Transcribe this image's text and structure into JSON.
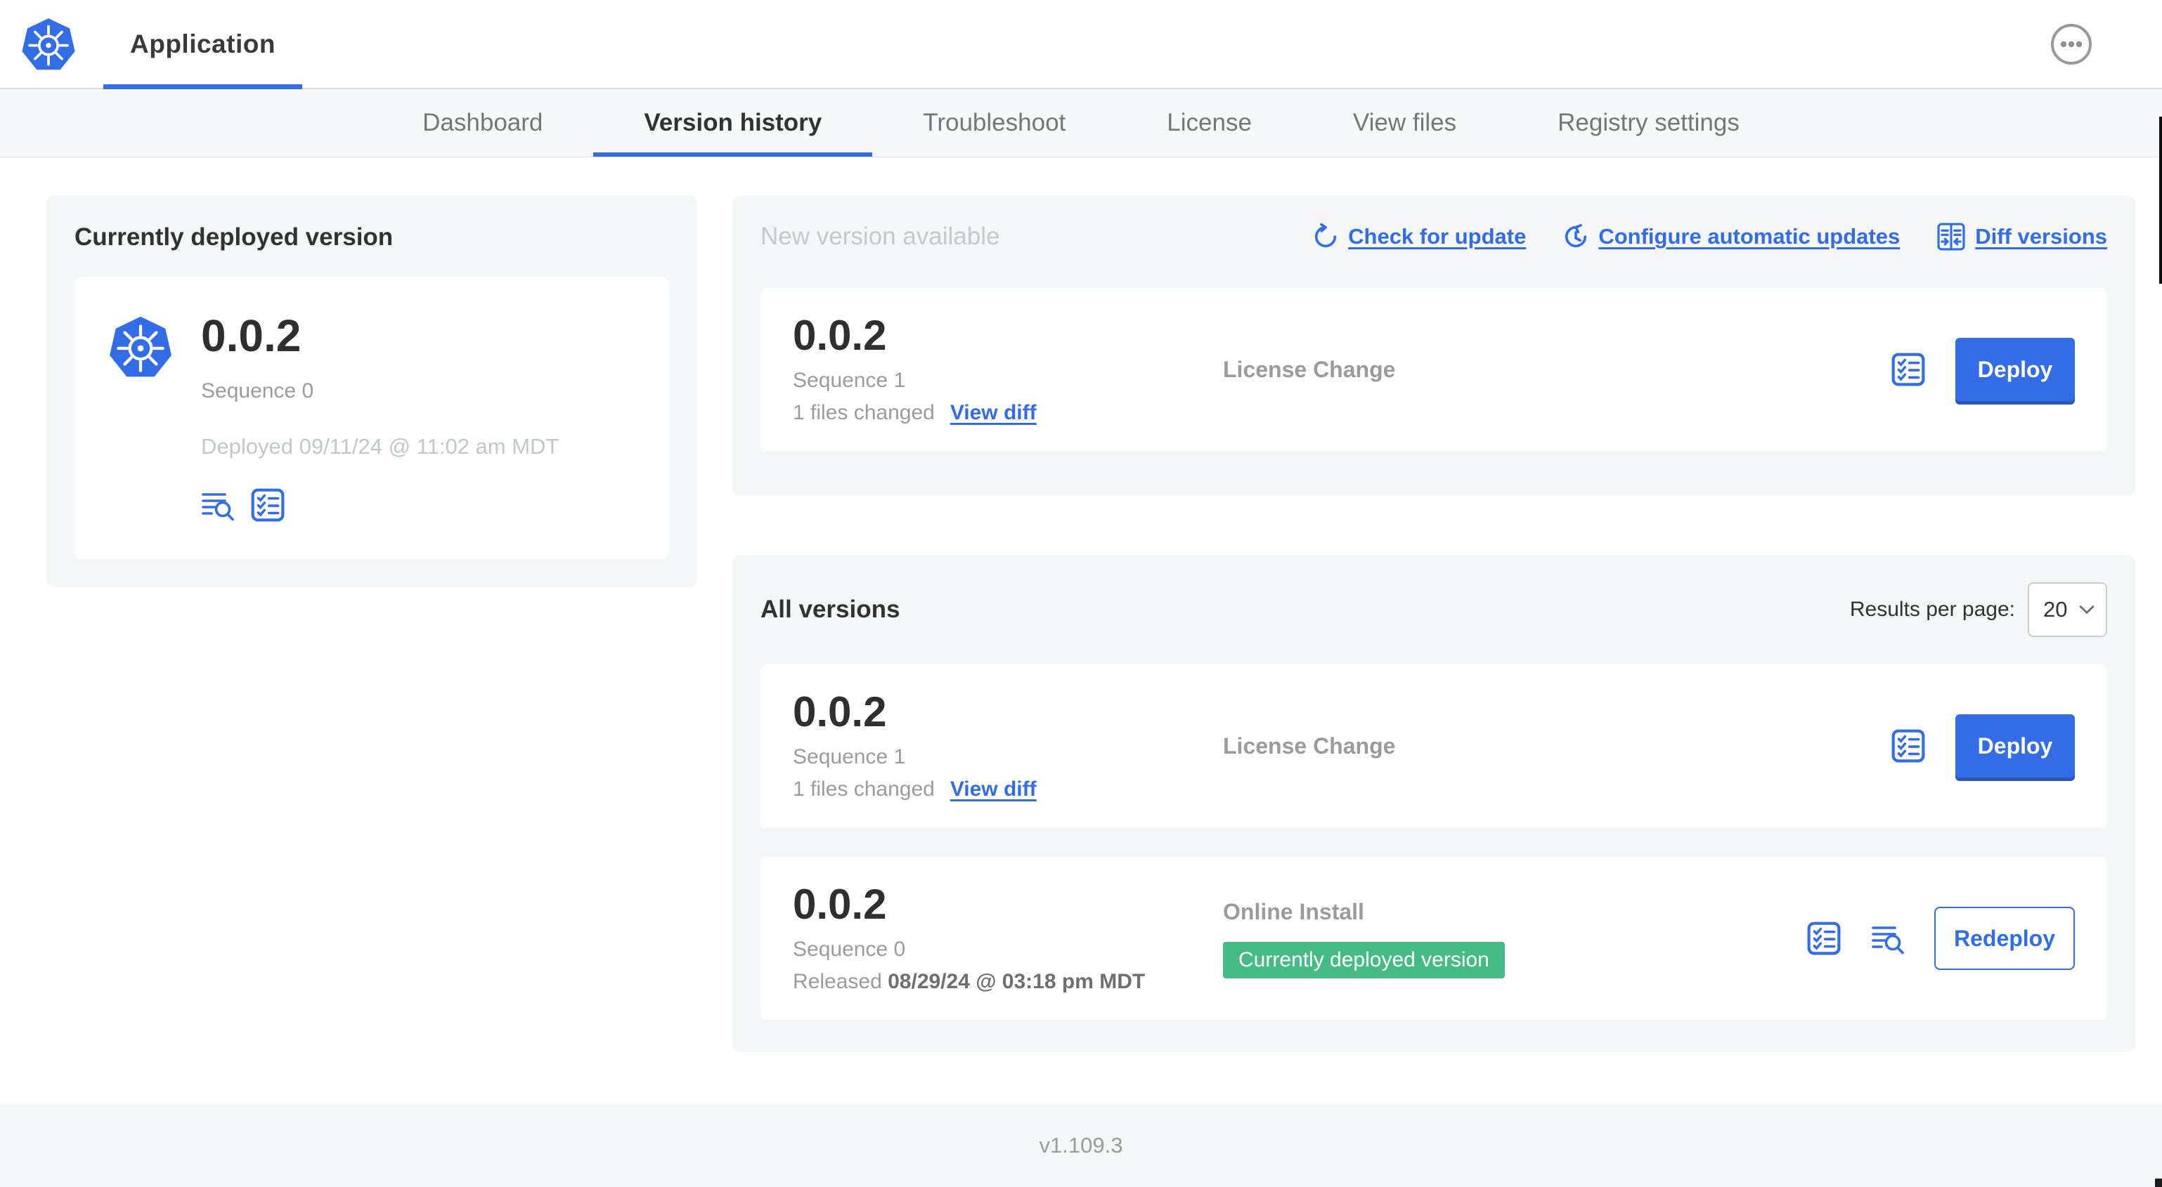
{
  "colors": {
    "accent": "#326de6",
    "badge_green": "#47bb87"
  },
  "header": {
    "app_title": "Application"
  },
  "nav": {
    "tabs": [
      {
        "label": "Dashboard",
        "active": false
      },
      {
        "label": "Version history",
        "active": true
      },
      {
        "label": "Troubleshoot",
        "active": false
      },
      {
        "label": "License",
        "active": false
      },
      {
        "label": "View files",
        "active": false
      },
      {
        "label": "Registry settings",
        "active": false
      }
    ]
  },
  "currently_deployed": {
    "title": "Currently deployed version",
    "version": "0.0.2",
    "sequence": "Sequence 0",
    "deployed_at": "Deployed 09/11/24 @ 11:02 am MDT"
  },
  "new_version": {
    "title": "New version available",
    "actions": [
      {
        "label": "Check for update",
        "icon": "refresh-icon"
      },
      {
        "label": "Configure automatic updates",
        "icon": "auto-update-schedule-icon"
      },
      {
        "label": "Diff versions",
        "icon": "diff-versions-icon"
      }
    ],
    "row": {
      "version": "0.0.2",
      "sequence": "Sequence 1",
      "files_changed": "1 files changed",
      "view_diff_label": "View diff",
      "source": "License Change",
      "deploy_label": "Deploy"
    }
  },
  "all_versions": {
    "title": "All versions",
    "results_per_page_label": "Results per page:",
    "results_per_page_value": "20",
    "rows": [
      {
        "version": "0.0.2",
        "sequence": "Sequence 1",
        "files_changed": "1 files changed",
        "view_diff_label": "View diff",
        "source": "License Change",
        "deploy_label": "Deploy"
      },
      {
        "version": "0.0.2",
        "sequence": "Sequence 0",
        "released_prefix": "Released",
        "released_date": "08/29/24 @ 03:18 pm MDT",
        "source": "Online Install",
        "badge": "Currently deployed version",
        "redeploy_label": "Redeploy"
      }
    ]
  },
  "footer": {
    "app_version": "v1.109.3"
  }
}
